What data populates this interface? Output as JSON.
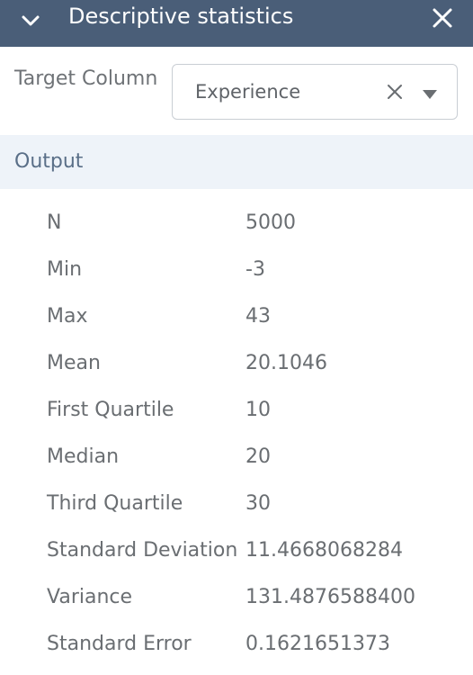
{
  "header": {
    "title": "Descriptive statistics",
    "background": "#4a5e78"
  },
  "target": {
    "label": "Target Column",
    "selected_value": "Experience"
  },
  "output": {
    "label": "Output",
    "background": "#eef3f9"
  },
  "stats": [
    {
      "name": "N",
      "value": "5000"
    },
    {
      "name": "Min",
      "value": "-3"
    },
    {
      "name": "Max",
      "value": "43"
    },
    {
      "name": "Mean",
      "value": "20.1046"
    },
    {
      "name": "First Quartile",
      "value": "10"
    },
    {
      "name": "Median",
      "value": "20"
    },
    {
      "name": "Third Quartile",
      "value": "30"
    },
    {
      "name": "Standard Deviation",
      "value": "11.4668068284"
    },
    {
      "name": "Variance",
      "value": "131.4876588400"
    },
    {
      "name": "Standard Error",
      "value": "0.1621651373"
    }
  ],
  "icons": {
    "collapse": "chevron-down-icon",
    "close": "close-icon",
    "clear": "clear-icon",
    "dropdown": "dropdown-arrow-icon"
  }
}
